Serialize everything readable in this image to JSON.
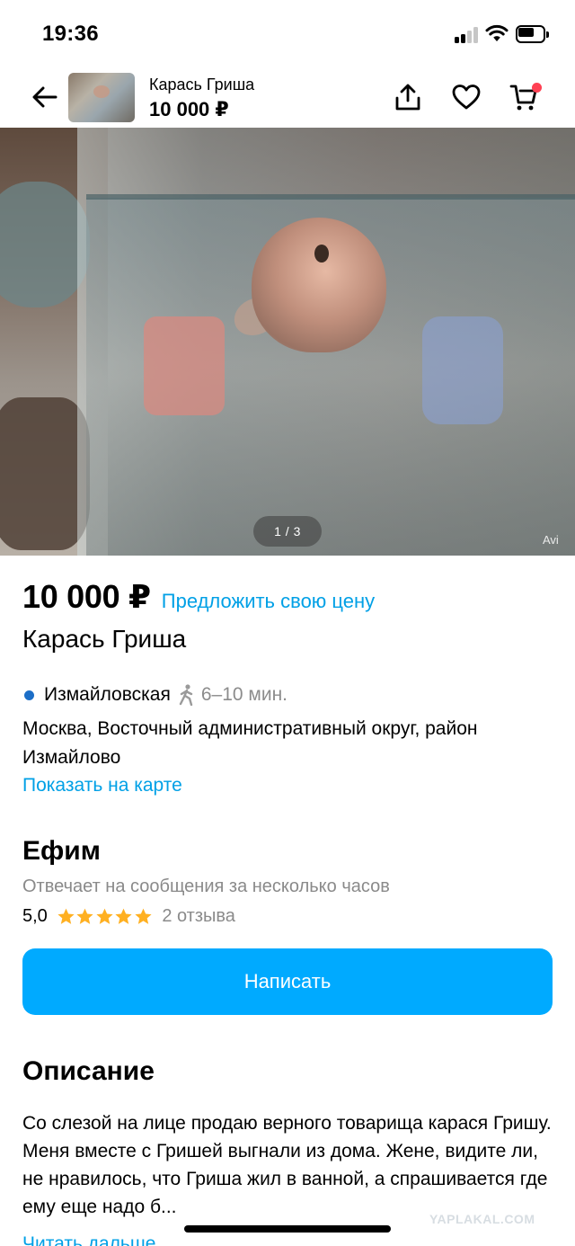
{
  "status_bar": {
    "time": "19:36"
  },
  "header": {
    "back_icon": "arrow-left-icon",
    "title": "Карась Гриша",
    "price": "10 000 ₽",
    "share_icon": "share-icon",
    "favorite_icon": "heart-icon",
    "cart_icon": "cart-icon"
  },
  "gallery": {
    "page_indicator": "1 / 3",
    "watermark": "Avi"
  },
  "listing": {
    "price": "10 000 ₽",
    "offer_link": "Предложить свою цену",
    "title": "Карась Гриша",
    "metro_station": "Измайловская",
    "walk_time": "6–10 мин.",
    "address": "Москва, Восточный административный округ, район Измайлово",
    "map_link": "Показать на карте"
  },
  "seller": {
    "name": "Ефим",
    "reply_time": "Отвечает на сообщения за несколько часов",
    "rating": "5,0",
    "stars": 5,
    "reviews": "2 отзыва"
  },
  "actions": {
    "write_button": "Написать"
  },
  "description": {
    "heading": "Описание",
    "text": "Со слезой на лице продаю верного товарища карася Гришу. Меня вместе с Гришей выгнали из дома. Жене, видите ли, не нравилось, что Гриша жил в ванной, а спрашивается где ему еще надо б...",
    "more_link": "Читать дальше"
  },
  "overlay": {
    "site_watermark": "YAPLAKAL.COM"
  },
  "colors": {
    "accent_blue": "#00aaff",
    "link_blue": "#00a0e6",
    "metro_line": "#1c6ec7",
    "star": "#ffb021",
    "cart_badge": "#ff4053"
  }
}
